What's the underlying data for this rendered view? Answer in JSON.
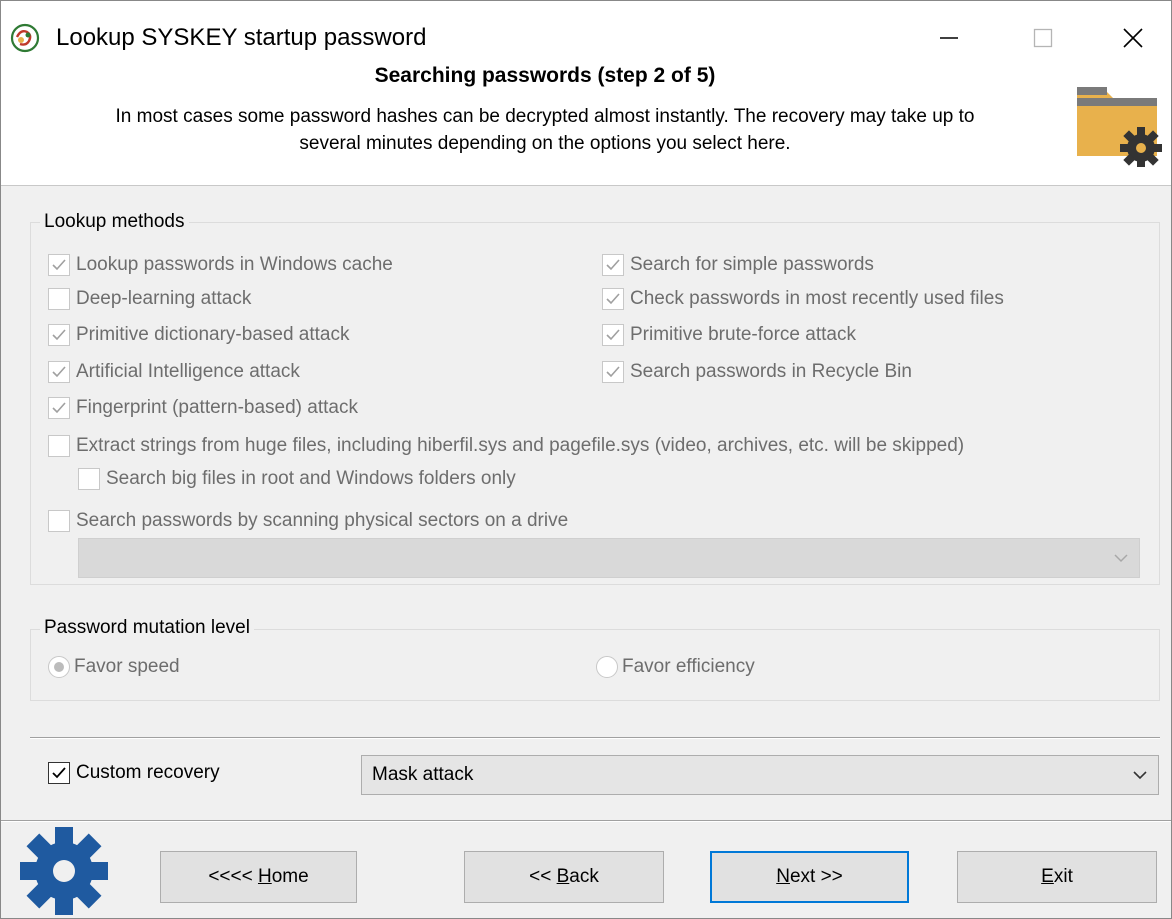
{
  "window": {
    "title": "Lookup SYSKEY startup password",
    "controls": {
      "minimize": "minimize",
      "maximize": "maximize",
      "close": "close"
    }
  },
  "header": {
    "step_title": "Searching passwords (step 2 of 5)",
    "description_line1": "In most cases some password hashes can be decrypted almost instantly. The recovery may take up to",
    "description_line2": "several minutes depending on the options you select here.",
    "icon": "folder-gear-icon"
  },
  "lookup_methods": {
    "title": "Lookup methods",
    "left": [
      {
        "label": "Lookup passwords in Windows cache",
        "checked": true
      },
      {
        "label": "Deep-learning attack",
        "checked": false
      },
      {
        "label": "Primitive dictionary-based attack",
        "checked": true
      },
      {
        "label": "Artificial Intelligence attack",
        "checked": true
      },
      {
        "label": "Fingerprint (pattern-based) attack",
        "checked": true
      }
    ],
    "right": [
      {
        "label": "Search for simple passwords",
        "checked": true
      },
      {
        "label": "Check passwords in most recently used files",
        "checked": true
      },
      {
        "label": "Primitive brute-force attack",
        "checked": true
      },
      {
        "label": "Search passwords in Recycle Bin",
        "checked": true
      }
    ],
    "extract_strings": {
      "label": "Extract strings from huge files, including hiberfil.sys and pagefile.sys (video, archives, etc. will be skipped)",
      "checked": false
    },
    "search_big_files": {
      "label": "Search big files in root and Windows folders only",
      "checked": false
    },
    "scan_sectors": {
      "label": "Search passwords by scanning physical sectors on a drive",
      "checked": false
    },
    "drive_select_value": ""
  },
  "mutation": {
    "title": "Password mutation level",
    "options": [
      {
        "label": "Favor speed",
        "selected": true
      },
      {
        "label": "Favor efficiency",
        "selected": false
      }
    ]
  },
  "custom_recovery": {
    "label": "Custom recovery",
    "checked": true,
    "select_value": "Mask attack"
  },
  "buttons": {
    "home": {
      "prefix": "<<<< ",
      "accel": "H",
      "rest": "ome"
    },
    "back": {
      "prefix": "<< ",
      "accel": "B",
      "rest": "ack"
    },
    "next": {
      "accel": "N",
      "rest": "ext >>"
    },
    "exit": {
      "accel": "E",
      "rest": "xit"
    }
  },
  "icons": {
    "app": "app-logo-icon",
    "bottom": "gear-icon"
  },
  "colors": {
    "accent": "#0078d7",
    "folder": "#e8b14c",
    "gear": "#1f5aa0"
  }
}
